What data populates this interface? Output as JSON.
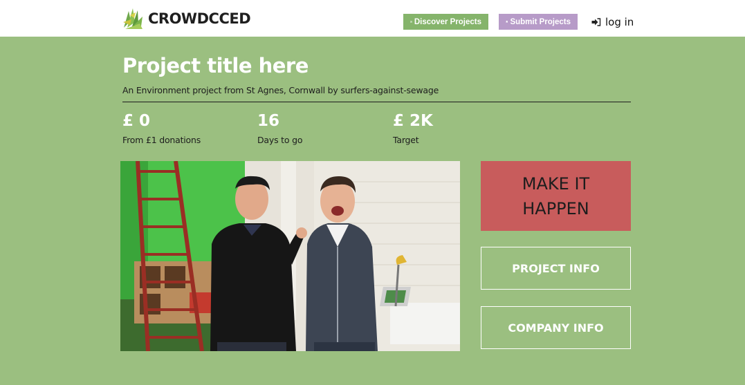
{
  "header": {
    "brand": "CROWDCCED",
    "nav": {
      "discover": "Discover Projects",
      "submit": "Submit Projects",
      "login": "log in"
    }
  },
  "project": {
    "title": "Project title here",
    "subtitle": "An Environment project from St Agnes, Cornwall by surfers-against-sewage",
    "stats": [
      {
        "value": "£ 0",
        "label": "From £1 donations"
      },
      {
        "value": "16",
        "label": "Days to go"
      },
      {
        "value": "£ 2K",
        "label": "Target"
      }
    ]
  },
  "actions": {
    "make_it_happen": "MAKE IT HAPPEN",
    "project_info": "PROJECT INFO",
    "company_info": "COMPANY INFO"
  },
  "colors": {
    "page_bg": "#9bbf80",
    "discover_btn": "#85b46b",
    "submit_btn": "#b79bc8",
    "make_btn": "#c85c5c"
  },
  "icons": {
    "logo": "leaf-logo-icon",
    "discover": "play-square-icon",
    "submit": "bookmark-icon",
    "login": "sign-in-icon"
  }
}
